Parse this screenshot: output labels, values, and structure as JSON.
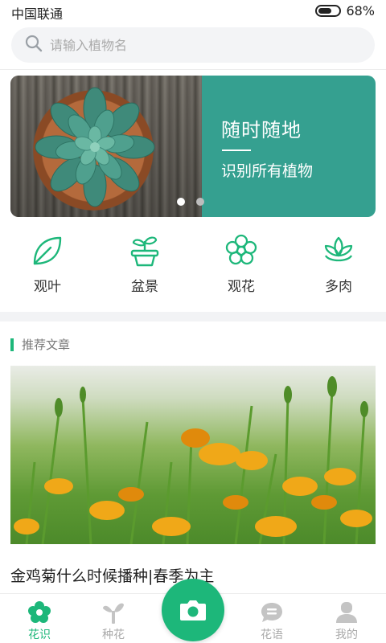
{
  "status": {
    "carrier": "中国联通",
    "battery": "68%",
    "battery_level": 0.68
  },
  "search": {
    "placeholder": "请输入植物名",
    "icon": "search-icon"
  },
  "banner": {
    "title": "随时随地",
    "subtitle": "识别所有植物",
    "slides": 2,
    "active_slide": 0
  },
  "categories": [
    {
      "label": "观叶",
      "icon": "leaf-icon"
    },
    {
      "label": "盆景",
      "icon": "potted-plant-icon"
    },
    {
      "label": "观花",
      "icon": "flower-icon"
    },
    {
      "label": "多肉",
      "icon": "succulent-icon"
    }
  ],
  "section": {
    "title": "推荐文章"
  },
  "article": {
    "title": "金鸡菊什么时候播种|春季为主"
  },
  "tabs": [
    {
      "label": "花识",
      "icon": "flower-icon",
      "active": true
    },
    {
      "label": "种花",
      "icon": "sprout-icon",
      "active": false
    },
    {
      "label": "花语",
      "icon": "chat-icon",
      "active": false
    },
    {
      "label": "我的",
      "icon": "user-icon",
      "active": false
    }
  ],
  "camera": {
    "icon": "camera-icon"
  },
  "colors": {
    "accent": "#1db77a",
    "banner_bg": "#35a090"
  }
}
